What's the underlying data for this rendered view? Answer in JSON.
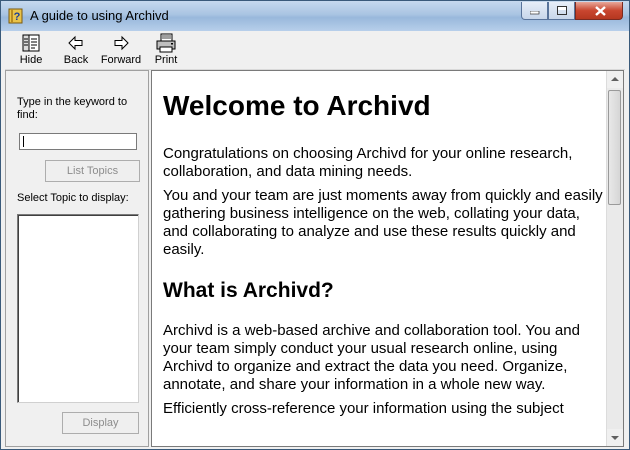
{
  "window": {
    "title": "A guide to using Archivd",
    "controls": {
      "minimize": "minimize",
      "maximize": "maximize",
      "close": "close"
    }
  },
  "toolbar": {
    "hide_label": "Hide",
    "back_label": "Back",
    "forward_label": "Forward",
    "print_label": "Print"
  },
  "left_pane": {
    "keyword_label": "Type in the keyword to find:",
    "keyword_value": "",
    "list_topics_button": "List Topics",
    "topic_label": "Select Topic to display:",
    "display_button": "Display"
  },
  "content": {
    "heading": "Welcome to Archivd",
    "p1": "Congratulations on choosing Archivd for your online research, collaboration, and data mining needs.",
    "p2": "You and your team are just moments away from quickly and easily gathering business intelligence on the web, collating your data, and collaborating to analyze and use these results quickly and easily.",
    "subheading": "What is Archivd?",
    "p3": "Archivd is a web-based archive and collaboration tool. You and your team simply conduct your usual research online, using Archivd to organize and extract the data you need. Organize, annotate, and share your information in a whole new way.",
    "p4": "Efficiently cross-reference your information using the subject"
  },
  "colors": {
    "title_bar": "#a9c4e2",
    "close_button": "#c9462f",
    "disabled_text": "#8d8d8d"
  }
}
